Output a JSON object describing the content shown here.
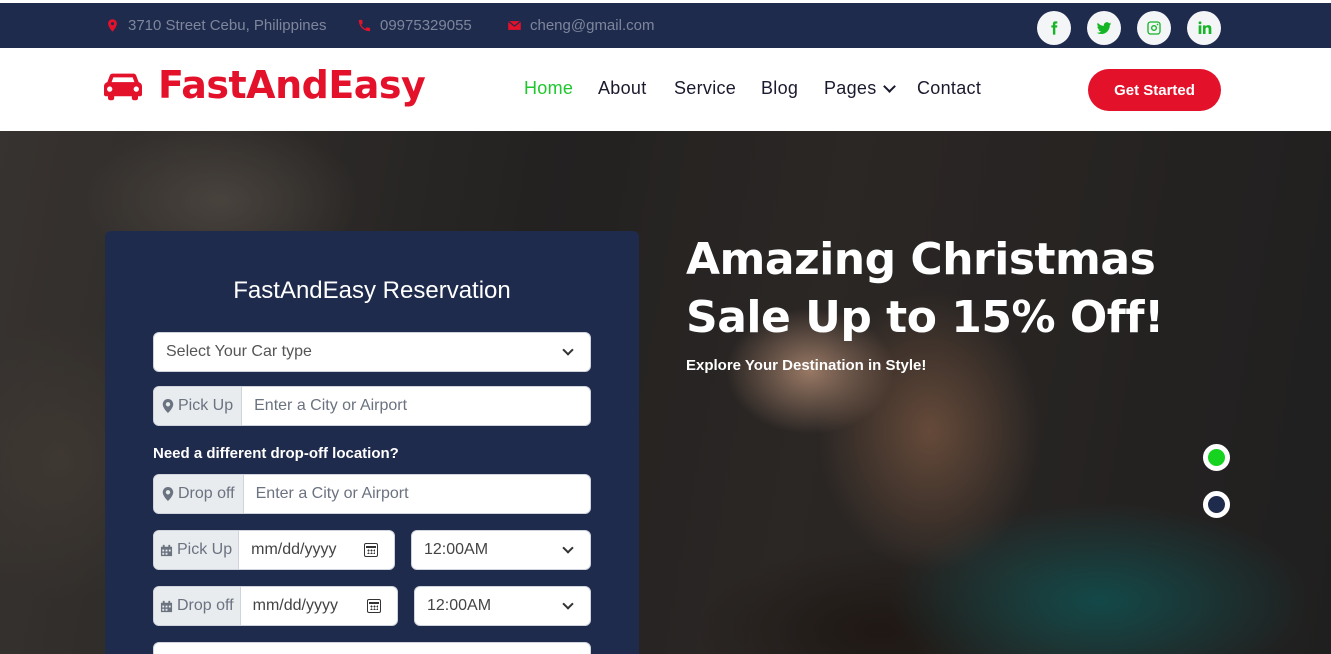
{
  "topbar": {
    "address": "3710 Street Cebu, Philippines",
    "phone": "09975329055",
    "email": "cheng@gmail.com",
    "social": [
      "f",
      "twitter",
      "instagram",
      "in"
    ]
  },
  "navbar": {
    "brand": "FastAndEasy",
    "items": [
      {
        "label": "Home",
        "active": true
      },
      {
        "label": "About"
      },
      {
        "label": "Service"
      },
      {
        "label": "Blog"
      },
      {
        "label": "Pages"
      },
      {
        "label": "Contact"
      }
    ],
    "cta": "Get Started"
  },
  "hero": {
    "headline_line1": "Amazing Christmas",
    "headline_line2": "Sale Up to 15% Off!",
    "subline": "Explore Your Destination in Style!",
    "active_slide": 1,
    "slide_count": 2
  },
  "reservation": {
    "title": "FastAndEasy Reservation",
    "car_type": "Select Your Car type",
    "pickup_label": "Pick Up",
    "pickup_placeholder": "Enter a City or Airport",
    "dropoff_question": "Need a different drop-off location?",
    "dropoff_label": "Drop off",
    "dropoff_placeholder": "Enter a City or Airport",
    "pickup_date_label": "Pick Up",
    "pickup_date": "mm/dd/yyyy",
    "pickup_time": "12:00AM",
    "dropoff_date_label": "Drop off",
    "dropoff_date": "mm/dd/yyyy",
    "dropoff_time": "12:00AM"
  },
  "colors": {
    "navy": "#1f2b4d",
    "brand_red": "#e4112b",
    "active_green": "#1ec72c"
  }
}
